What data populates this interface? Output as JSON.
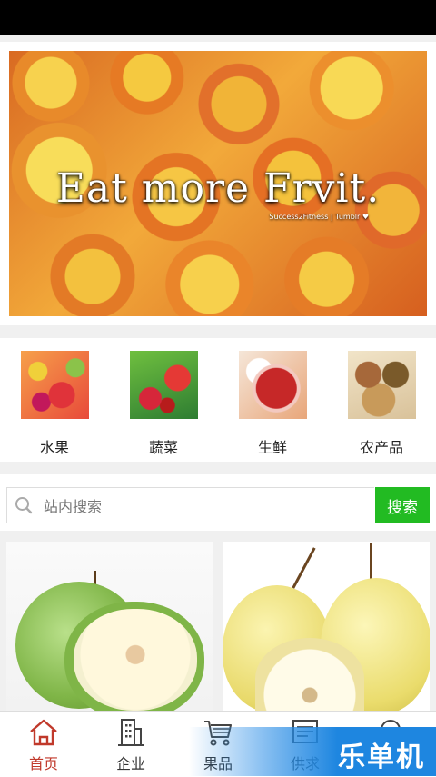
{
  "banner": {
    "headline": "Eat more Frvit.",
    "credit": "Success2Fitness | Tumblr ♥"
  },
  "categories": [
    {
      "label": "水果",
      "icon": "fruit-thumbnail"
    },
    {
      "label": "蔬菜",
      "icon": "vegetable-thumbnail"
    },
    {
      "label": "生鲜",
      "icon": "fresh-meat-thumbnail"
    },
    {
      "label": "农产品",
      "icon": "farm-produce-thumbnail"
    }
  ],
  "search": {
    "placeholder": "站内搜索",
    "button_label": "搜索",
    "button_color": "#22bb22"
  },
  "products": [
    {
      "icon": "green-apple-image"
    },
    {
      "icon": "pear-image"
    }
  ],
  "tabbar": {
    "items": [
      {
        "label": "首页",
        "icon": "home-icon",
        "active": true
      },
      {
        "label": "企业",
        "icon": "building-icon",
        "active": false
      },
      {
        "label": "果品",
        "icon": "cart-icon",
        "active": false
      },
      {
        "label": "供求",
        "icon": "notice-icon",
        "active": false
      },
      {
        "label": "",
        "icon": "search-icon",
        "active": false
      }
    ],
    "active_color": "#c0392b"
  },
  "watermark": {
    "text": "乐单机"
  }
}
